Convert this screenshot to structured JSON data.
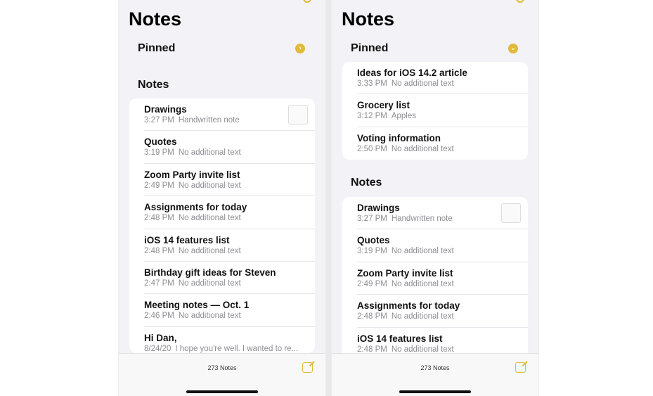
{
  "accent": "#e2b93b",
  "left": {
    "title": "Notes",
    "pinned_label": "Pinned",
    "pinned_icon": "chevron-right-icon",
    "notes_label": "Notes",
    "notes": [
      {
        "title": "Drawings",
        "date": "3:27 PM",
        "preview": "Handwritten note",
        "thumb": true
      },
      {
        "title": "Quotes",
        "date": "3:19 PM",
        "preview": "No additional text"
      },
      {
        "title": "Zoom Party invite list",
        "date": "2:49 PM",
        "preview": "No additional text"
      },
      {
        "title": "Assignments for today",
        "date": "2:48 PM",
        "preview": "No additional text"
      },
      {
        "title": "iOS 14 features list",
        "date": "2:48 PM",
        "preview": "No additional text"
      },
      {
        "title": "Birthday gift ideas for Steven",
        "date": "2:47 PM",
        "preview": "No additional text"
      },
      {
        "title": "Meeting notes — Oct. 1",
        "date": "2:46 PM",
        "preview": "No additional text"
      },
      {
        "title": "Hi Dan,",
        "date": "8/24/20",
        "preview": "I hope you're well. I wanted to re..."
      }
    ],
    "count": "273 Notes"
  },
  "right": {
    "title": "Notes",
    "pinned_label": "Pinned",
    "pinned_icon": "chevron-down-icon",
    "notes_label": "Notes",
    "pinned": [
      {
        "title": "Ideas for iOS 14.2 article",
        "date": "3:33 PM",
        "preview": "No additional text"
      },
      {
        "title": "Grocery list",
        "date": "3:12 PM",
        "preview": "Apples"
      },
      {
        "title": "Voting information",
        "date": "2:50 PM",
        "preview": "No additional text"
      }
    ],
    "notes": [
      {
        "title": "Drawings",
        "date": "3:27 PM",
        "preview": "Handwritten note",
        "thumb": true
      },
      {
        "title": "Quotes",
        "date": "3:19 PM",
        "preview": "No additional text"
      },
      {
        "title": "Zoom Party invite list",
        "date": "2:49 PM",
        "preview": "No additional text"
      },
      {
        "title": "Assignments for today",
        "date": "2:48 PM",
        "preview": "No additional text"
      },
      {
        "title": "iOS 14 features list",
        "date": "2:48 PM",
        "preview": "No additional text"
      }
    ],
    "count": "273 Notes"
  }
}
